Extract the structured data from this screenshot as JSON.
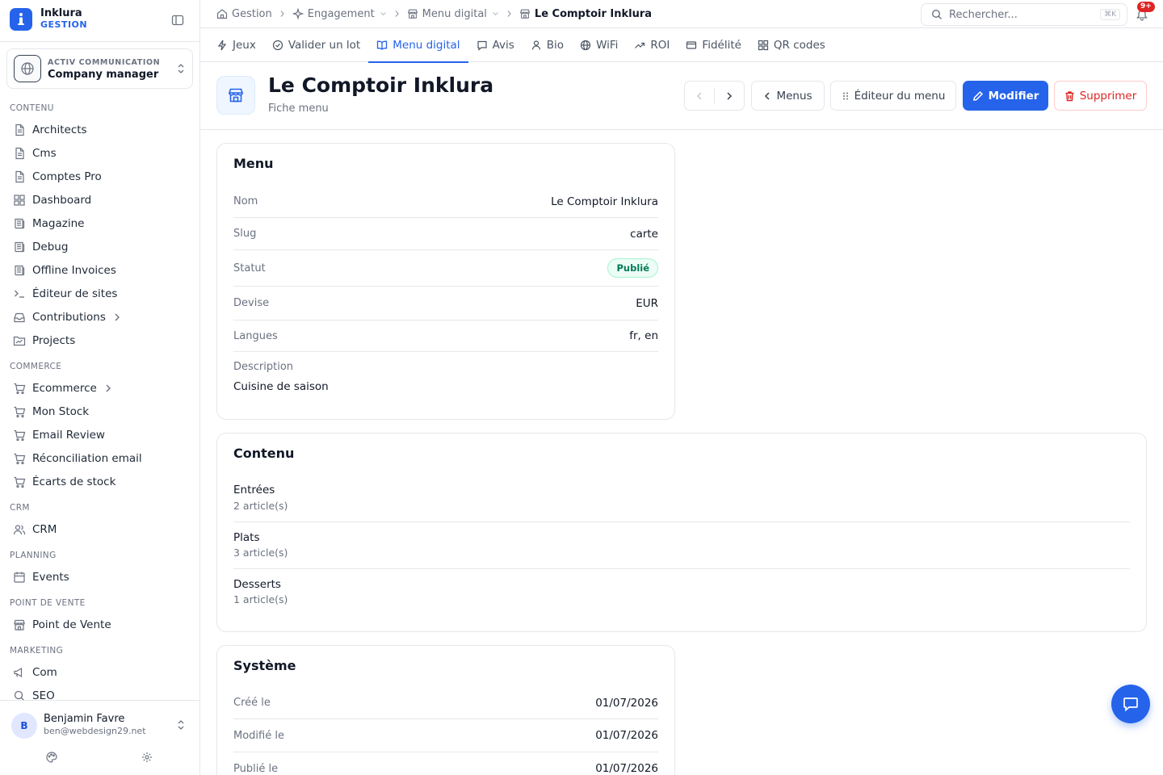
{
  "brand": {
    "name": "Inklura",
    "sub": "GESTION"
  },
  "company": {
    "org": "ACTIV COMMUNICATION",
    "role": "Company manager"
  },
  "sidebar": {
    "sections": [
      {
        "title": "CONTENU",
        "items": [
          {
            "label": "Architects",
            "icon": "document-icon"
          },
          {
            "label": "Cms",
            "icon": "document-icon"
          },
          {
            "label": "Comptes Pro",
            "icon": "document-icon"
          },
          {
            "label": "Dashboard",
            "icon": "grid-icon"
          },
          {
            "label": "Magazine",
            "icon": "newspaper-icon"
          },
          {
            "label": "Debug",
            "icon": "newspaper-icon"
          },
          {
            "label": "Offline Invoices",
            "icon": "newspaper-icon"
          },
          {
            "label": "Éditeur de sites",
            "icon": "terminal-icon"
          },
          {
            "label": "Contributions",
            "icon": "inbox-icon",
            "expandable": true
          },
          {
            "label": "Projects",
            "icon": "folder-icon"
          }
        ]
      },
      {
        "title": "COMMERCE",
        "items": [
          {
            "label": "Ecommerce",
            "icon": "cart-icon",
            "expandable": true
          },
          {
            "label": "Mon Stock",
            "icon": "cart-icon"
          },
          {
            "label": "Email Review",
            "icon": "cart-icon"
          },
          {
            "label": "Réconciliation email",
            "icon": "cart-icon"
          },
          {
            "label": "Écarts de stock",
            "icon": "cart-icon"
          }
        ]
      },
      {
        "title": "CRM",
        "items": [
          {
            "label": "CRM",
            "icon": "users-icon"
          }
        ]
      },
      {
        "title": "PLANNING",
        "items": [
          {
            "label": "Events",
            "icon": "calendar-icon"
          }
        ]
      },
      {
        "title": "POINT DE VENTE",
        "items": [
          {
            "label": "Point de Vente",
            "icon": "store-icon"
          }
        ]
      },
      {
        "title": "MARKETING",
        "items": [
          {
            "label": "Com",
            "icon": "megaphone-icon"
          },
          {
            "label": "SEO",
            "icon": "search-icon"
          }
        ]
      }
    ]
  },
  "user": {
    "initial": "B",
    "name": "Benjamin Favre",
    "email": "ben@webdesign29.net"
  },
  "breadcrumb": {
    "items": [
      {
        "label": "Gestion",
        "icon": "home-icon"
      },
      {
        "label": "Engagement",
        "icon": "sparkle-icon",
        "dropdown": true
      },
      {
        "label": "Menu digital",
        "icon": "store-icon",
        "dropdown": true
      },
      {
        "label": "Le Comptoir Inklura",
        "icon": "store-icon",
        "current": true
      }
    ]
  },
  "search": {
    "placeholder": "Rechercher...",
    "shortcut": "⌘K"
  },
  "notifications": {
    "badge": "9+"
  },
  "tabs": [
    {
      "label": "Jeux",
      "icon": "bolt-icon"
    },
    {
      "label": "Valider un lot",
      "icon": "check-circle-icon"
    },
    {
      "label": "Menu digital",
      "icon": "book-icon",
      "active": true
    },
    {
      "label": "Avis",
      "icon": "chat-icon"
    },
    {
      "label": "Bio",
      "icon": "user-icon"
    },
    {
      "label": "WiFi",
      "icon": "globe-icon"
    },
    {
      "label": "ROI",
      "icon": "trend-icon"
    },
    {
      "label": "Fidélité",
      "icon": "card-icon"
    },
    {
      "label": "QR codes",
      "icon": "qr-icon"
    }
  ],
  "header": {
    "title": "Le Comptoir Inklura",
    "subtitle": "Fiche menu",
    "menus_label": "Menus",
    "editor_label": "Éditeur du menu",
    "edit_label": "Modifier",
    "delete_label": "Supprimer"
  },
  "menu_card": {
    "title": "Menu",
    "rows": [
      {
        "label": "Nom",
        "value": "Le Comptoir Inklura"
      },
      {
        "label": "Slug",
        "value": "carte"
      },
      {
        "label": "Statut",
        "value": "Publié",
        "badge": true
      },
      {
        "label": "Devise",
        "value": "EUR"
      },
      {
        "label": "Langues",
        "value": "fr, en"
      }
    ],
    "description_label": "Description",
    "description_value": "Cuisine de saison"
  },
  "content_card": {
    "title": "Contenu",
    "categories": [
      {
        "name": "Entrées",
        "count": "2 article(s)"
      },
      {
        "name": "Plats",
        "count": "3 article(s)"
      },
      {
        "name": "Desserts",
        "count": "1 article(s)"
      }
    ]
  },
  "system_card": {
    "title": "Système",
    "rows": [
      {
        "label": "Créé le",
        "value": "01/07/2026"
      },
      {
        "label": "Modifié le",
        "value": "01/07/2026"
      },
      {
        "label": "Publié le",
        "value": "01/07/2026"
      }
    ]
  },
  "colors": {
    "accent": "#2563eb",
    "danger": "#dc2626",
    "success": "#047857"
  }
}
